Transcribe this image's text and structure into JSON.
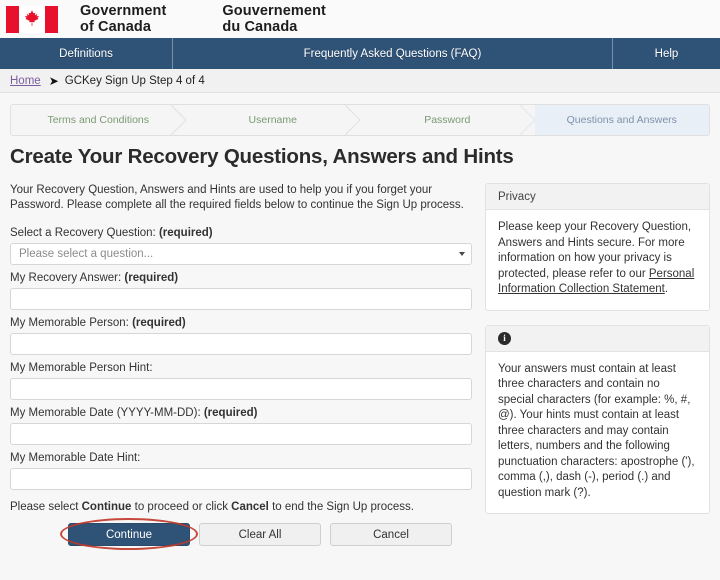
{
  "brand": {
    "flag_icon": "canada-flag-icon",
    "en_line1": "Government",
    "en_line2": "of Canada",
    "fr_line1": "Gouvernement",
    "fr_line2": "du Canada"
  },
  "topnav": {
    "definitions": "Definitions",
    "faq": "Frequently Asked Questions (FAQ)",
    "help": "Help",
    "bg_color": "#2f5277"
  },
  "breadcrumb": {
    "home": "Home",
    "arrow_icon": "arrow-right-icon",
    "current": "GCKey Sign Up Step 4 of 4"
  },
  "steps": [
    {
      "label": "Terms and Conditions",
      "state": "done"
    },
    {
      "label": "Username",
      "state": "done"
    },
    {
      "label": "Password",
      "state": "done"
    },
    {
      "label": "Questions and Answers",
      "state": "current"
    }
  ],
  "page": {
    "title": "Create Your Recovery Questions, Answers and Hints",
    "rule_color": "#9b4a4a",
    "intro": "Your Recovery Question, Answers and Hints are used to help you if you forget your Password. Please complete all the required fields below to continue the Sign Up process."
  },
  "form": {
    "required_suffix": "(required)",
    "fields": [
      {
        "label": "Select a Recovery Question:",
        "required": true,
        "type": "select",
        "value": "",
        "placeholder": "Please select a question..."
      },
      {
        "label": "My Recovery Answer:",
        "required": true,
        "type": "text",
        "value": "",
        "placeholder": ""
      },
      {
        "label": "My Memorable Person:",
        "required": true,
        "type": "text",
        "value": "",
        "placeholder": ""
      },
      {
        "label": "My Memorable Person Hint:",
        "required": false,
        "type": "text",
        "value": "",
        "placeholder": ""
      },
      {
        "label": "My Memorable Date (YYYY-MM-DD):",
        "required": true,
        "type": "text",
        "value": "",
        "placeholder": ""
      },
      {
        "label": "My Memorable Date Hint:",
        "required": false,
        "type": "text",
        "value": "",
        "placeholder": ""
      }
    ],
    "note_before": "Please select ",
    "note_continue": "Continue",
    "note_middle": " to proceed or click ",
    "note_cancel": "Cancel",
    "note_after": " to end the Sign Up process."
  },
  "buttons": {
    "continue": "Continue",
    "clear_all": "Clear All",
    "cancel": "Cancel",
    "highlight_color": "#c0392b"
  },
  "privacy_panel": {
    "heading": "Privacy",
    "body_before": "Please keep your Recovery Question, Answers and Hints secure. For more information on how your privacy is protected, please refer to our ",
    "link": "Personal Information Collection Statement",
    "body_after": "."
  },
  "info_panel": {
    "icon": "info-circle-icon",
    "icon_glyph": "i",
    "body": "Your answers must contain at least three characters and contain no special characters (for example: %, #, @). Your hints must contain at least three characters and may contain letters, numbers and the following punctuation characters: apostrophe ('), comma (,), dash (-), period (.) and question mark (?)."
  }
}
